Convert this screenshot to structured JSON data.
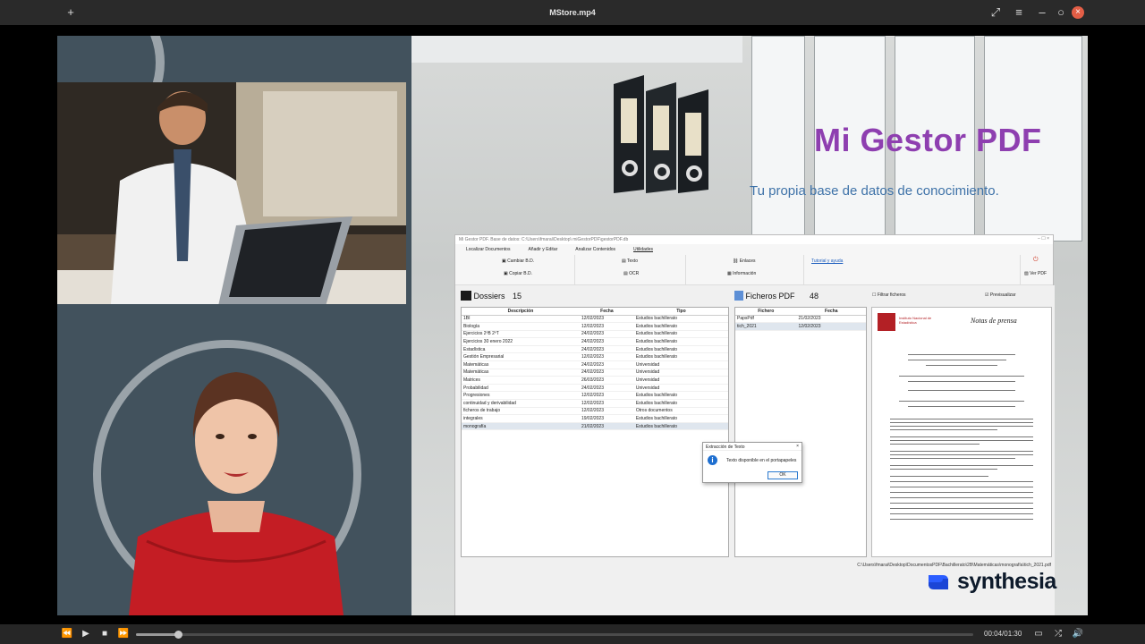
{
  "window": {
    "title": "MStore.mp4"
  },
  "brand": {
    "title": "Mi Gestor PDF",
    "subtitle": "Tu propia base de datos de conocimiento."
  },
  "app": {
    "titlebar": "Mi Gestor PDF. Base de datos: C:\\Users\\fmarai\\Desktop\\ miGestorPDF\\gestorPDF.db",
    "menu": [
      "Localizar Documentos",
      "Añadir y Editar",
      "Analizar Contenidos",
      "Utilidades"
    ],
    "ribbon": {
      "cambiar": "Cambiar B.D.",
      "copiar": "Copiar B.D.",
      "texto": "Texto",
      "ocr": "OCR",
      "enlaces": "Enlaces",
      "informacion": "Información",
      "tutorial": "Tutorial y ayuda",
      "ver_pdf": "Ver PDF"
    },
    "dossiers": {
      "label": "Dossiers",
      "count": "15",
      "columns": [
        "Descripción",
        "Fecha",
        "Tipo"
      ],
      "rows": [
        [
          "1BI",
          "12/02/2023",
          "Estudios bachillerato"
        ],
        [
          "Biología",
          "12/02/2023",
          "Estudios bachillerato"
        ],
        [
          "Ejercicios 2ºB 2ºT",
          "24/02/2023",
          "Estudios bachillerato"
        ],
        [
          "Ejercicios 30 enero 2022",
          "24/02/2023",
          "Estudios bachillerato"
        ],
        [
          "Estadística",
          "24/02/2023",
          "Estudios bachillerato"
        ],
        [
          "Gestión Empresarial",
          "12/02/2023",
          "Estudios bachillerato"
        ],
        [
          "Matemáticas",
          "24/02/2023",
          "Universidad"
        ],
        [
          "Matemáticas",
          "24/02/2023",
          "Universidad"
        ],
        [
          "Matrices",
          "26/03/2023",
          "Universidad"
        ],
        [
          "Probabilidad",
          "24/02/2023",
          "Universidad"
        ],
        [
          "Progresiones",
          "12/02/2023",
          "Estudios bachillerato"
        ],
        [
          "continuidad y derivabilidad",
          "12/02/2023",
          "Estudios bachillerato"
        ],
        [
          "ficheros de trabajo",
          "12/02/2023",
          "Otros documentos"
        ],
        [
          "integrales",
          "19/02/2023",
          "Estudios bachillerato"
        ],
        [
          "monografía",
          "21/02/2023",
          "Estudios bachillerato"
        ]
      ]
    },
    "ficheros": {
      "label": "Ficheros PDF",
      "count": "48",
      "columns": [
        "Fichero",
        "Fecha"
      ],
      "rows": [
        [
          "PapsPdf",
          "21/02/2023"
        ],
        [
          "tich_2021",
          "12/02/2023"
        ]
      ]
    },
    "filtrar": "Filtrar ficheros",
    "previsualizar": "Previsualizar",
    "status_path": "C:\\Users\\fmarai\\Desktop\\DocumentosPDF\\Bachillerato\\2B\\Matemáticas\\monografía\\tich_2021.pdf",
    "preview": {
      "org": "Instituto Nacional de Estadística",
      "heading": "Notas de prensa"
    }
  },
  "dialog": {
    "title": "Extracción de Texto",
    "message": "Texto disponible en el portapapeles",
    "ok": "OK",
    "close": "×"
  },
  "watermark": {
    "text": "synthesia"
  },
  "player": {
    "time": "00:04/01:30",
    "progress": 0.05
  }
}
